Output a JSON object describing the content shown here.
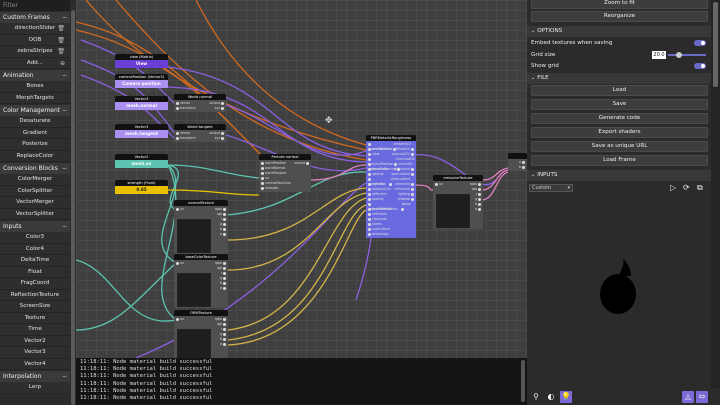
{
  "left_panel": {
    "filter_placeholder": "Filter",
    "categories": [
      {
        "title": "Custom Frames",
        "items": [
          {
            "label": "directionSlider",
            "trash": true
          },
          {
            "label": "OOB",
            "trash": true
          },
          {
            "label": "zebraStripes",
            "trash": true
          },
          {
            "label": "Add...",
            "trash": true
          }
        ]
      },
      {
        "title": "Animation",
        "items": [
          {
            "label": "Bones"
          },
          {
            "label": "MorphTargets"
          }
        ]
      },
      {
        "title": "Color Management",
        "items": [
          {
            "label": "Desaturate"
          },
          {
            "label": "Gradient"
          },
          {
            "label": "Posterize"
          },
          {
            "label": "ReplaceColor"
          }
        ]
      },
      {
        "title": "Conversion Blocks",
        "items": [
          {
            "label": "ColorMerger"
          },
          {
            "label": "ColorSplitter"
          },
          {
            "label": "VectorMerger"
          },
          {
            "label": "VectorSplitter"
          }
        ]
      },
      {
        "title": "Inputs",
        "items": [
          {
            "label": "Color3"
          },
          {
            "label": "Color4"
          },
          {
            "label": "DeltaTime"
          },
          {
            "label": "Float"
          },
          {
            "label": "FragCoord"
          },
          {
            "label": "ReflectionTexture"
          },
          {
            "label": "ScreenSize"
          },
          {
            "label": "Texture"
          },
          {
            "label": "Time"
          },
          {
            "label": "Vector2"
          },
          {
            "label": "Vector3"
          },
          {
            "label": "Vector4"
          }
        ]
      },
      {
        "title": "Interpolation",
        "items": [
          {
            "label": "Lerp"
          }
        ]
      }
    ]
  },
  "graph": {
    "nodes": {
      "view": {
        "title": "view (Matrix)",
        "value": "View",
        "color": "#6b3fd4"
      },
      "camera": {
        "title": "cameraPosition (Vector3)",
        "value": "Camera position",
        "color": "#a98ff0"
      },
      "v3a": {
        "title": "Vector3",
        "value": "mesh.normal",
        "color": "#a98ff0"
      },
      "v3b": {
        "title": "Vector3",
        "value": "mesh.tangent",
        "color": "#a98ff0"
      },
      "v2": {
        "title": "Vector2",
        "value": "mesh.uv",
        "color": "#5cc4b0"
      },
      "strength": {
        "title": "strength (Float)",
        "value": "0.85",
        "color": "#e8c200"
      },
      "world_normal": {
        "title": "World normal",
        "rows": [
          [
            "vector",
            "output"
          ],
          [
            "transform",
            "xyz"
          ]
        ]
      },
      "world_tangent": {
        "title": "World tangent",
        "rows": [
          [
            "vector",
            "output"
          ],
          [
            "transform",
            "xyz"
          ]
        ]
      },
      "perturb": {
        "title": "Perturb normal",
        "rows": [
          [
            "worldPosition",
            "output"
          ],
          [
            "worldNormal",
            ""
          ],
          [
            "worldTangent",
            ""
          ],
          [
            "uv",
            ""
          ],
          [
            "normalMapColor",
            ""
          ],
          [
            "strength",
            ""
          ]
        ]
      },
      "normal_tex": {
        "title": "normalTexture",
        "rows": [
          [
            "uv",
            "rgba"
          ],
          [
            "",
            "rgb"
          ],
          [
            "",
            "r"
          ],
          [
            "",
            "g"
          ],
          [
            "",
            "b"
          ],
          [
            "",
            "a"
          ]
        ]
      },
      "base_tex": {
        "title": "baseColorTexture",
        "rows": [
          [
            "uv",
            "rgba"
          ],
          [
            "",
            "rgb"
          ],
          [
            "",
            "r"
          ],
          [
            "",
            "g"
          ],
          [
            "",
            "b"
          ],
          [
            "",
            "a"
          ]
        ]
      },
      "orm_tex": {
        "title": "ORMTexture",
        "rows": [
          [
            "uv",
            "rgba"
          ],
          [
            "",
            "rgb"
          ],
          [
            "",
            "r"
          ],
          [
            "",
            "g"
          ],
          [
            "",
            "b"
          ],
          [
            "",
            "a"
          ]
        ]
      },
      "pbr": {
        "title": "PBRMetallicRoughness",
        "rows": [
          [
            "worldPosition",
            "ambientClr"
          ],
          [
            "worldNormal",
            "diffuseDir"
          ],
          [
            "view",
            "specularDir"
          ],
          [
            "cameraPosition",
            "clearcoatDir"
          ],
          [
            "perturbedNormal",
            "sheenDir"
          ],
          [
            "baseColor",
            "diffuseInd"
          ],
          [
            "opacity",
            "specularInd"
          ],
          [
            "roughness",
            "clearcoatInd"
          ],
          [
            "metallic",
            "sheenInd"
          ],
          [
            "ambientOcc",
            "refraction"
          ],
          [
            "reflection",
            "lighting"
          ],
          [
            "opacity",
            "shadow"
          ],
          [
            "indexOfRefraction",
            "alpha"
          ],
          [
            "perturbedUV",
            ""
          ],
          [
            "reflection",
            ""
          ],
          [
            "clearcoat",
            ""
          ],
          [
            "sheen",
            ""
          ],
          [
            "subSurface",
            ""
          ],
          [
            "anisotropy",
            ""
          ]
        ]
      },
      "emissive": {
        "title": "emissiveTexture",
        "rows": [
          [
            "uv",
            "rgba"
          ],
          [
            "",
            "rgb"
          ],
          [
            "",
            "r"
          ],
          [
            "",
            "g"
          ],
          [
            "",
            "b"
          ],
          [
            "",
            "a"
          ]
        ]
      },
      "out": {
        "title": "",
        "rows": [
          [
            "",
            "a"
          ],
          [
            "",
            "b"
          ]
        ]
      }
    }
  },
  "console": {
    "lines": [
      "11:18:11: Node material build successful",
      "11:18:11: Node material build successful",
      "11:18:11: Node material build successful",
      "11:18:11: Node material build successful",
      "11:18:11: Node material build successful",
      "11:18:11: Node material build successful"
    ]
  },
  "right_panel": {
    "zoom_to_fit": "Zoom to fit",
    "reorganize": "Reorganize",
    "options_title": "OPTIONS",
    "embed_textures": "Embed textures when saving",
    "grid_size_label": "Grid size",
    "grid_size_value": "20.0",
    "show_grid": "Show grid",
    "file_title": "FILE",
    "file_buttons": [
      "Load",
      "Save",
      "Generate code",
      "Export shaders",
      "Save as unique URL",
      "Load Frame"
    ],
    "inputs_title": "INPUTS",
    "inputs_dropdown": "Custom",
    "accent_color": "#6a6ac8"
  }
}
